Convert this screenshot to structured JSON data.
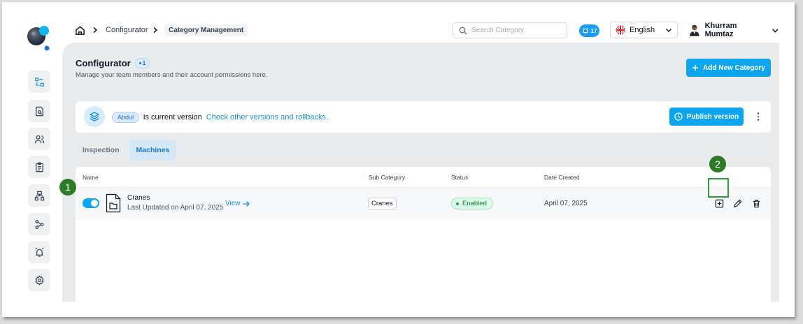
{
  "breadcrumb": {
    "items": [
      "Configurator"
    ],
    "current": "Category Management"
  },
  "search": {
    "placeholder": "Search Category",
    "value": ""
  },
  "notifications": {
    "count": "17"
  },
  "language": {
    "selected": "English"
  },
  "user": {
    "name": "Khurram Mumtaz"
  },
  "page": {
    "title": "Configurator",
    "badge": "1",
    "subtitle": "Manage your team members and their account permissions here.",
    "add_button": "Add New Category"
  },
  "version": {
    "name": "Abdul",
    "text": "is current version",
    "link": "Check other versions and rollbacks.",
    "publish_button": "Publish version"
  },
  "tabs": [
    {
      "label": "Inspection",
      "active": false
    },
    {
      "label": "Machines",
      "active": true
    }
  ],
  "table": {
    "columns": [
      "Name",
      "Sub Category",
      "Status",
      "Date Created"
    ],
    "rows": [
      {
        "name": "Cranes",
        "updated": "Last Updated on April 07, 2025",
        "view_link": "View",
        "sub_category": "Cranes",
        "status": "Enabled",
        "date_created": "April 07, 2025",
        "enabled": true
      }
    ]
  },
  "annotations": {
    "marker_1": "1",
    "marker_2": "2",
    "highlight_color": "#2e9a3a"
  },
  "colors": {
    "accent": "#0ea5f0",
    "marker": "#2d7a27"
  }
}
